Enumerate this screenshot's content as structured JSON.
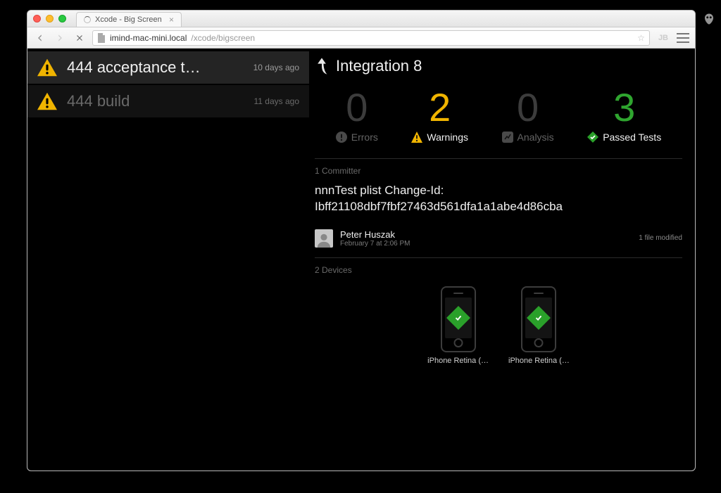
{
  "browser": {
    "tab_title": "Xcode - Big Screen",
    "url_host": "imind-mac-mini.local",
    "url_path": "/xcode/bigscreen",
    "badge": "JB"
  },
  "bots": [
    {
      "title": "444 acceptance t…",
      "age": "10 days ago",
      "status": "warning",
      "selected": true
    },
    {
      "title": "444 build",
      "age": "11 days ago",
      "status": "warning",
      "selected": false
    }
  ],
  "integration": {
    "label": "Integration 8",
    "stats": {
      "errors": {
        "value": "0",
        "label": "Errors"
      },
      "warnings": {
        "value": "2",
        "label": "Warnings"
      },
      "analysis": {
        "value": "0",
        "label": "Analysis"
      },
      "passed": {
        "value": "3",
        "label": "Passed Tests"
      }
    },
    "committers_label": "1 Committer",
    "commit_message": "nnnTest plist Change-Id: Ibff21108dbf7fbf27463d561dfa1a1abe4d86cba",
    "committer": {
      "name": "Peter Huszak",
      "date": "February 7 at 2:06 PM",
      "files": "1 file modified"
    },
    "devices_label": "2 Devices",
    "devices": [
      {
        "label": "iPhone Retina (…"
      },
      {
        "label": "iPhone Retina (…"
      }
    ]
  }
}
